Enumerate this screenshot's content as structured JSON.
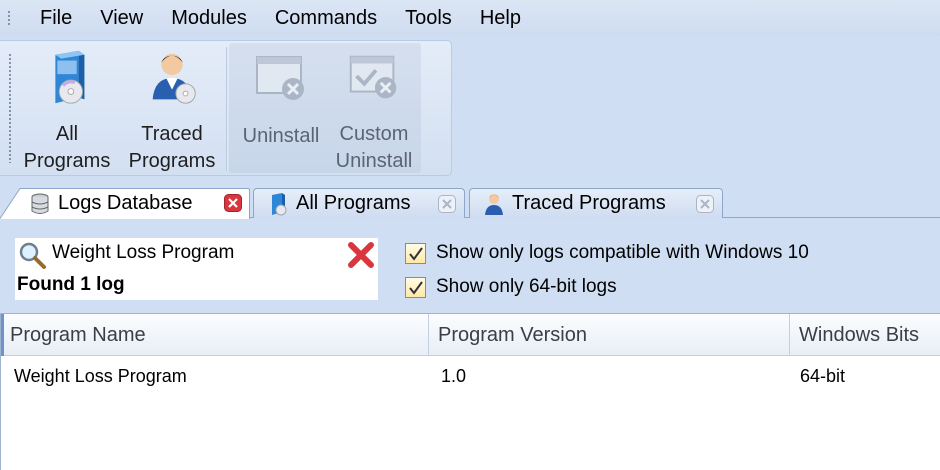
{
  "menu": [
    "File",
    "View",
    "Modules",
    "Commands",
    "Tools",
    "Help"
  ],
  "toolbar": {
    "all_programs": {
      "line1": "All",
      "line2": "Programs",
      "icon": "software-box-icon"
    },
    "traced_programs": {
      "line1": "Traced",
      "line2": "Programs",
      "icon": "user-with-disc-icon"
    },
    "uninstall": {
      "label": "Uninstall",
      "icon": "uninstall-window-icon"
    },
    "custom_uninstall": {
      "line1": "Custom",
      "line2": "Uninstall",
      "icon": "custom-uninstall-icon"
    }
  },
  "tabs": [
    {
      "label": "Logs Database",
      "active": true,
      "icon": "database-icon"
    },
    {
      "label": "All Programs",
      "active": false,
      "icon": "software-box-icon"
    },
    {
      "label": "Traced Programs",
      "active": false,
      "icon": "user-icon"
    }
  ],
  "search": {
    "value": "Weight Loss Program",
    "result": "Found 1 log"
  },
  "filters": {
    "windows10": {
      "label": "Show only logs compatible with Windows 10",
      "checked": true
    },
    "bits64": {
      "label": "Show only 64-bit logs",
      "checked": true
    }
  },
  "table": {
    "columns": [
      "Program Name",
      "Program Version",
      "Windows Bits"
    ],
    "rows": [
      [
        "Weight Loss Program",
        "1.0",
        "64-bit"
      ]
    ]
  },
  "colors": {
    "background": "#cfdef3",
    "close_red": "#d9363e",
    "tab_border": "#8ea6c9"
  }
}
